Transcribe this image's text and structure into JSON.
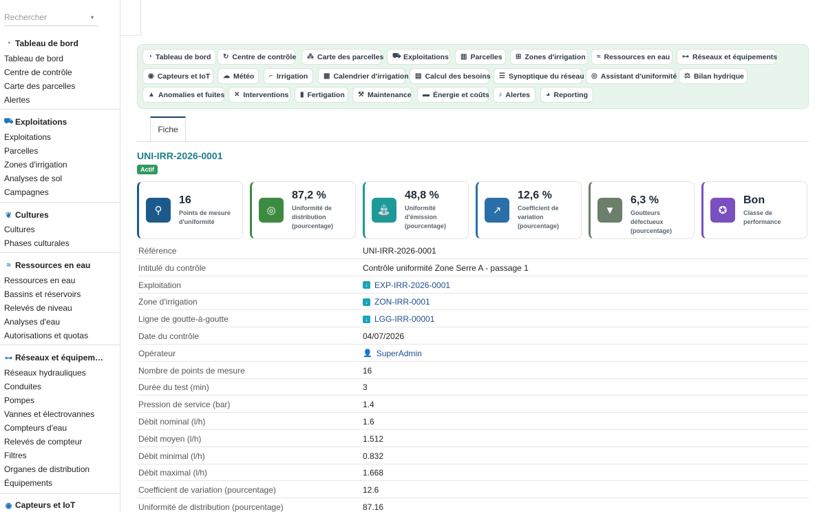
{
  "sidebar": {
    "search_placeholder": "Rechercher",
    "sections": [
      {
        "title": "Tableau de bord",
        "icon": "gauge-icon",
        "items": [
          "Tableau de bord",
          "Centre de contrôle",
          "Carte des parcelles",
          "Alertes"
        ]
      },
      {
        "title": "Exploitations",
        "icon": "tractor-icon",
        "items": [
          "Exploitations",
          "Parcelles",
          "Zones d'irrigation",
          "Analyses de sol",
          "Campagnes"
        ]
      },
      {
        "title": "Cultures",
        "icon": "seedling-icon",
        "items": [
          "Cultures",
          "Phases culturales"
        ]
      },
      {
        "title": "Ressources en eau",
        "icon": "water-icon",
        "items": [
          "Ressources en eau",
          "Bassins et réservoirs",
          "Relevés de niveau",
          "Analyses d'eau",
          "Autorisations et quotas"
        ]
      },
      {
        "title": "Réseaux et équipem…",
        "icon": "network-icon",
        "items": [
          "Réseaux hydrauliques",
          "Conduites",
          "Pompes",
          "Vannes et électrovannes",
          "Compteurs d'eau",
          "Relevés de compteur",
          "Filtres",
          "Organes de distribution",
          "Équipements"
        ]
      },
      {
        "title": "Capteurs et IoT",
        "icon": "sensor-icon",
        "items": []
      }
    ]
  },
  "nav": [
    {
      "label": "Tableau de bord",
      "icon": "gauge-icon"
    },
    {
      "label": "Centre de contrôle",
      "icon": "refresh-icon"
    },
    {
      "label": "Carte des parcelles",
      "icon": "map-cluster-icon"
    },
    {
      "label": "Exploitations",
      "icon": "tractor-icon"
    },
    {
      "label": "Parcelles",
      "icon": "map-icon"
    },
    {
      "label": "Zones d'irrigation",
      "icon": "sitemap-icon"
    },
    {
      "label": "Ressources en eau",
      "icon": "water-icon"
    },
    {
      "label": "Réseaux et équipements",
      "icon": "network-icon"
    },
    {
      "label": "Capteurs et IoT",
      "icon": "sensor-icon"
    },
    {
      "label": "Météo",
      "icon": "cloud-icon"
    },
    {
      "label": "Irrigation",
      "icon": "faucet-icon"
    },
    {
      "label": "Calendrier d'irrigation",
      "icon": "calendar-icon"
    },
    {
      "label": "Calcul des besoins",
      "icon": "calculator-icon"
    },
    {
      "label": "Synoptique du réseau",
      "icon": "list-icon"
    },
    {
      "label": "Assistant d'uniformité",
      "icon": "target-icon"
    },
    {
      "label": "Bilan hydrique",
      "icon": "scale-icon"
    },
    {
      "label": "Anomalies et fuites",
      "icon": "warning-icon"
    },
    {
      "label": "Interventions",
      "icon": "tools-icon"
    },
    {
      "label": "Fertigation",
      "icon": "bottle-icon"
    },
    {
      "label": "Maintenance",
      "icon": "wrench-icon"
    },
    {
      "label": "Énergie et coûts",
      "icon": "money-icon"
    },
    {
      "label": "Alertes",
      "icon": "bell-icon"
    },
    {
      "label": "Reporting",
      "icon": "pie-chart-icon"
    }
  ],
  "tabs": [
    "Fiche"
  ],
  "record": {
    "title": "UNI-IRR-2026-0001",
    "status": "Actif"
  },
  "cards": [
    {
      "value": "16",
      "label": "Points de mesure d'uniformité",
      "icon": "pin-icon",
      "color": "#1d5a8c"
    },
    {
      "value": "87,2 %",
      "label": "Uniformité de distribution (pourcentage)",
      "icon": "target-icon",
      "color": "#3d8b40"
    },
    {
      "value": "48,8 %",
      "label": "Uniformité d'émission (pourcentage)",
      "icon": "sprinkler-icon",
      "color": "#1d9a98"
    },
    {
      "value": "12,6 %",
      "label": "Coefficient de variation (pourcentage)",
      "icon": "chart-line-icon",
      "color": "#2a6fa8"
    },
    {
      "value": "6,3 %",
      "label": "Goutteurs défectueux (pourcentage)",
      "icon": "filter-icon",
      "color": "#6b7f6a"
    },
    {
      "value": "Bon",
      "label": "Classe de performance",
      "icon": "award-icon",
      "color": "#7a4fc0"
    }
  ],
  "details": [
    {
      "key": "Référence",
      "value": "UNI-IRR-2026-0001"
    },
    {
      "key": "Intitulé du contrôle",
      "value": "Contrôle uniformité Zone Serre A - passage 1"
    },
    {
      "key": "Exploitation",
      "value": "EXP-IRR-2026-0001",
      "link": true
    },
    {
      "key": "Zone d'irrigation",
      "value": "ZON-IRR-0001",
      "link": true
    },
    {
      "key": "Ligne de goutte-à-goutte",
      "value": "LGG-IRR-00001",
      "link": true
    },
    {
      "key": "Date du contrôle",
      "value": "04/07/2026"
    },
    {
      "key": "Opérateur",
      "value": "SuperAdmin",
      "user": true
    },
    {
      "key": "Nombre de points de mesure",
      "value": "16"
    },
    {
      "key": "Durée du test (min)",
      "value": "3"
    },
    {
      "key": "Pression de service (bar)",
      "value": "1.4"
    },
    {
      "key": "Débit nominal (l/h)",
      "value": "1.6"
    },
    {
      "key": "Débit moyen (l/h)",
      "value": "1.512"
    },
    {
      "key": "Débit minimal (l/h)",
      "value": "0.832"
    },
    {
      "key": "Débit maximal (l/h)",
      "value": "1.668"
    },
    {
      "key": "Coefficient de variation (pourcentage)",
      "value": "12.6"
    },
    {
      "key": "Uniformité de distribution (pourcentage)",
      "value": "87.16"
    }
  ]
}
